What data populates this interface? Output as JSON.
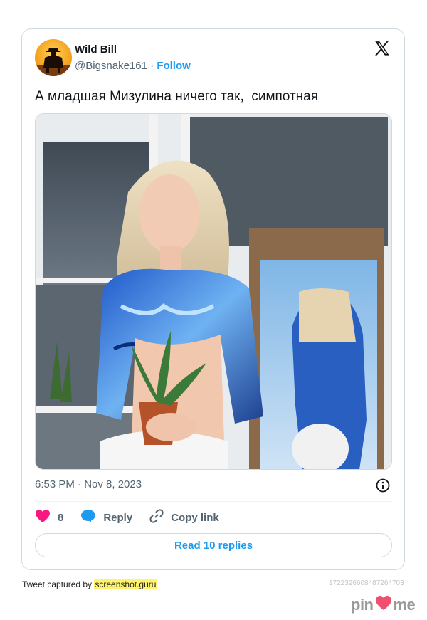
{
  "tweet": {
    "author_name": "Wild Bill",
    "author_handle": "@Bigsnake161",
    "separator": " · ",
    "follow_label": "Follow",
    "text": "А младшая Мизулина ничего так,  симпотная",
    "timestamp": "6:53 PM · Nov 8, 2023",
    "like_count": "8",
    "reply_label": "Reply",
    "copy_link_label": "Copy link",
    "read_replies_label": "Read 10 replies"
  },
  "footer": {
    "captured_prefix": "Tweet captured by ",
    "captured_site": "screenshot.guru",
    "id_text": "1722326608487264703"
  },
  "watermark": {
    "left": "pin",
    "right": "me"
  },
  "colors": {
    "accent": "#1d9bf0",
    "like": "#f91880",
    "border": "#cfd9de",
    "muted": "#536471"
  },
  "icons": [
    "avatar-cowboy",
    "x-logo-icon",
    "info-icon",
    "heart-icon",
    "reply-bubble-icon",
    "link-icon",
    "pinme-heart-icon"
  ]
}
